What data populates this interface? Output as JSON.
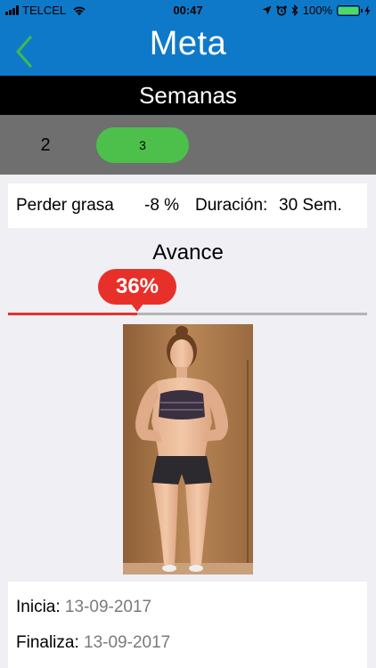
{
  "status_bar": {
    "carrier": "TELCEL",
    "time": "00:47",
    "battery": "100%",
    "battery_level": 1.0
  },
  "nav": {
    "title": "Meta",
    "back_icon": "chevron-left-icon",
    "accent_color": "#0f79c9",
    "back_color": "#3dba4d"
  },
  "weeks": {
    "header": "Semanas",
    "items": [
      {
        "label": "2",
        "selected": false
      },
      {
        "label": "3",
        "selected": true
      }
    ],
    "selected_color": "#4cc04a"
  },
  "goal": {
    "type": "Perder grasa",
    "percent": "-8 %",
    "duration_label": "Duración:",
    "duration_value": "30 Sem."
  },
  "progress": {
    "label": "Avance",
    "value_text": "36%",
    "value": 0.36,
    "color": "#e8302a"
  },
  "dates": {
    "start_label": "Inicia:",
    "start_value": "13-09-2017",
    "end_label": "Finaliza:",
    "end_value": "13-09-2017"
  }
}
